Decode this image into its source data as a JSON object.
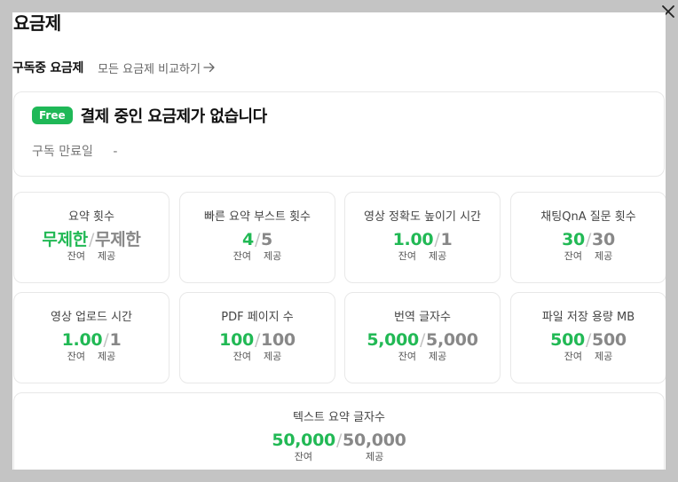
{
  "modal": {
    "title": "요금제",
    "subscription_label": "구독중 요금제",
    "compare_link": "모든 요금제 비교하기"
  },
  "plan": {
    "badge": "Free",
    "status": "결제 중인 요금제가 없습니다",
    "expiry_label": "구독 만료일",
    "expiry_value": "-"
  },
  "labels": {
    "remaining": "잔여",
    "provided": "제공",
    "separator": "/"
  },
  "stats": [
    {
      "label": "요약 횟수",
      "remaining": "무제한",
      "total": "무제한"
    },
    {
      "label": "빠른 요약 부스트 횟수",
      "remaining": "4",
      "total": "5"
    },
    {
      "label": "영상 정확도 높이기 시간",
      "remaining": "1.00",
      "total": "1"
    },
    {
      "label": "채팅QnA 질문 횟수",
      "remaining": "30",
      "total": "30"
    },
    {
      "label": "영상 업로드 시간",
      "remaining": "1.00",
      "total": "1"
    },
    {
      "label": "PDF 페이지 수",
      "remaining": "100",
      "total": "100"
    },
    {
      "label": "번역 글자수",
      "remaining": "5,000",
      "total": "5,000"
    },
    {
      "label": "파일 저장 용량 MB",
      "remaining": "500",
      "total": "500"
    },
    {
      "label": "텍스트 요약 글자수",
      "remaining": "50,000",
      "total": "50,000"
    }
  ],
  "colors": {
    "accent_green": "#22b955",
    "badge_green": "#1fb857",
    "overlay": "#c4c4c4"
  },
  "icons": {
    "close": "close-icon",
    "compare_arrow": "arrow-right-icon"
  }
}
